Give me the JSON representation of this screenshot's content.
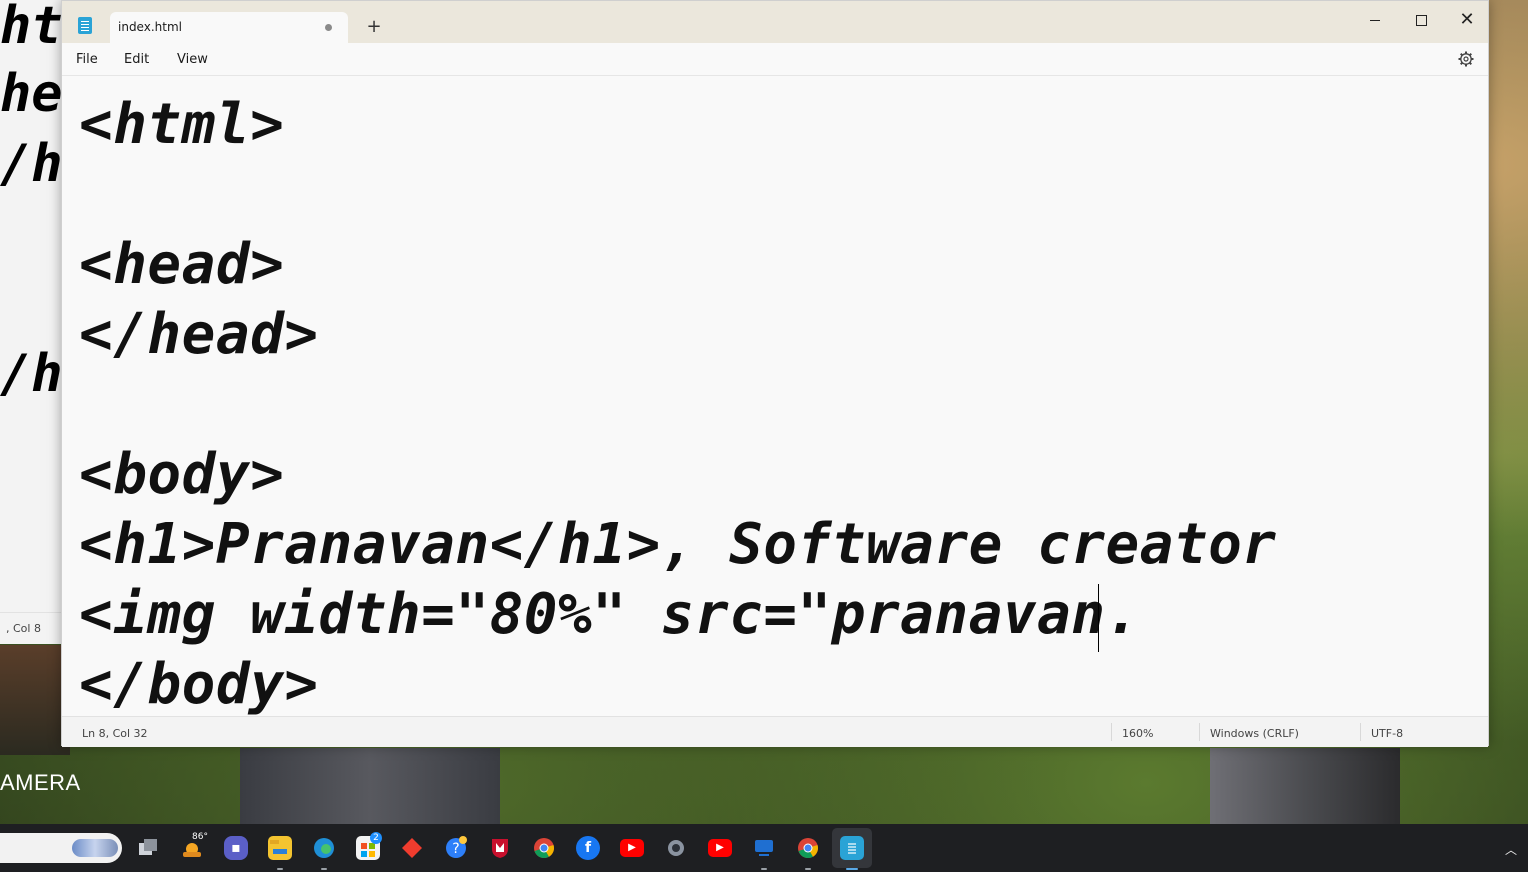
{
  "background_window": {
    "code_fragments": [
      "ht",
      "he",
      "/h",
      "/h"
    ],
    "status_text": ", Col 8"
  },
  "desktop": {
    "camera_label": "AMERA"
  },
  "window": {
    "tab_title": "index.html",
    "new_tab_symbol": "+",
    "controls": {
      "minimize": "minimize",
      "maximize": "maximize",
      "close": "✕"
    },
    "menu": {
      "file": "File",
      "edit": "Edit",
      "view": "View"
    }
  },
  "editor": {
    "lines": [
      "<html>",
      "",
      "<head>",
      "</head>",
      "",
      "<body>",
      "<h1>Pranavan</h1>, Software creator",
      "<img width=\"80%\" src=\"pranavan.",
      "</body>"
    ]
  },
  "status": {
    "position": "Ln 8, Col 32",
    "zoom": "160%",
    "line_ending": "Windows (CRLF)",
    "encoding": "UTF-8"
  },
  "taskbar": {
    "weather_temp": "86°",
    "store_badge": "2",
    "icons": [
      "search-box",
      "task-view-icon",
      "weather-icon",
      "teams-icon",
      "file-explorer-icon",
      "edge-icon",
      "store-icon",
      "git-icon",
      "help-icon",
      "mcafee-icon",
      "chrome-icon",
      "facebook-icon",
      "youtube-icon",
      "settings-icon",
      "youtube-icon",
      "remote-icon",
      "chrome-icon",
      "notepad-icon"
    ],
    "colors": {
      "youtube": "#ff0000",
      "facebook": "#1877f2",
      "mcafee": "#c8102e",
      "notepad": "#2aa3d6"
    }
  }
}
